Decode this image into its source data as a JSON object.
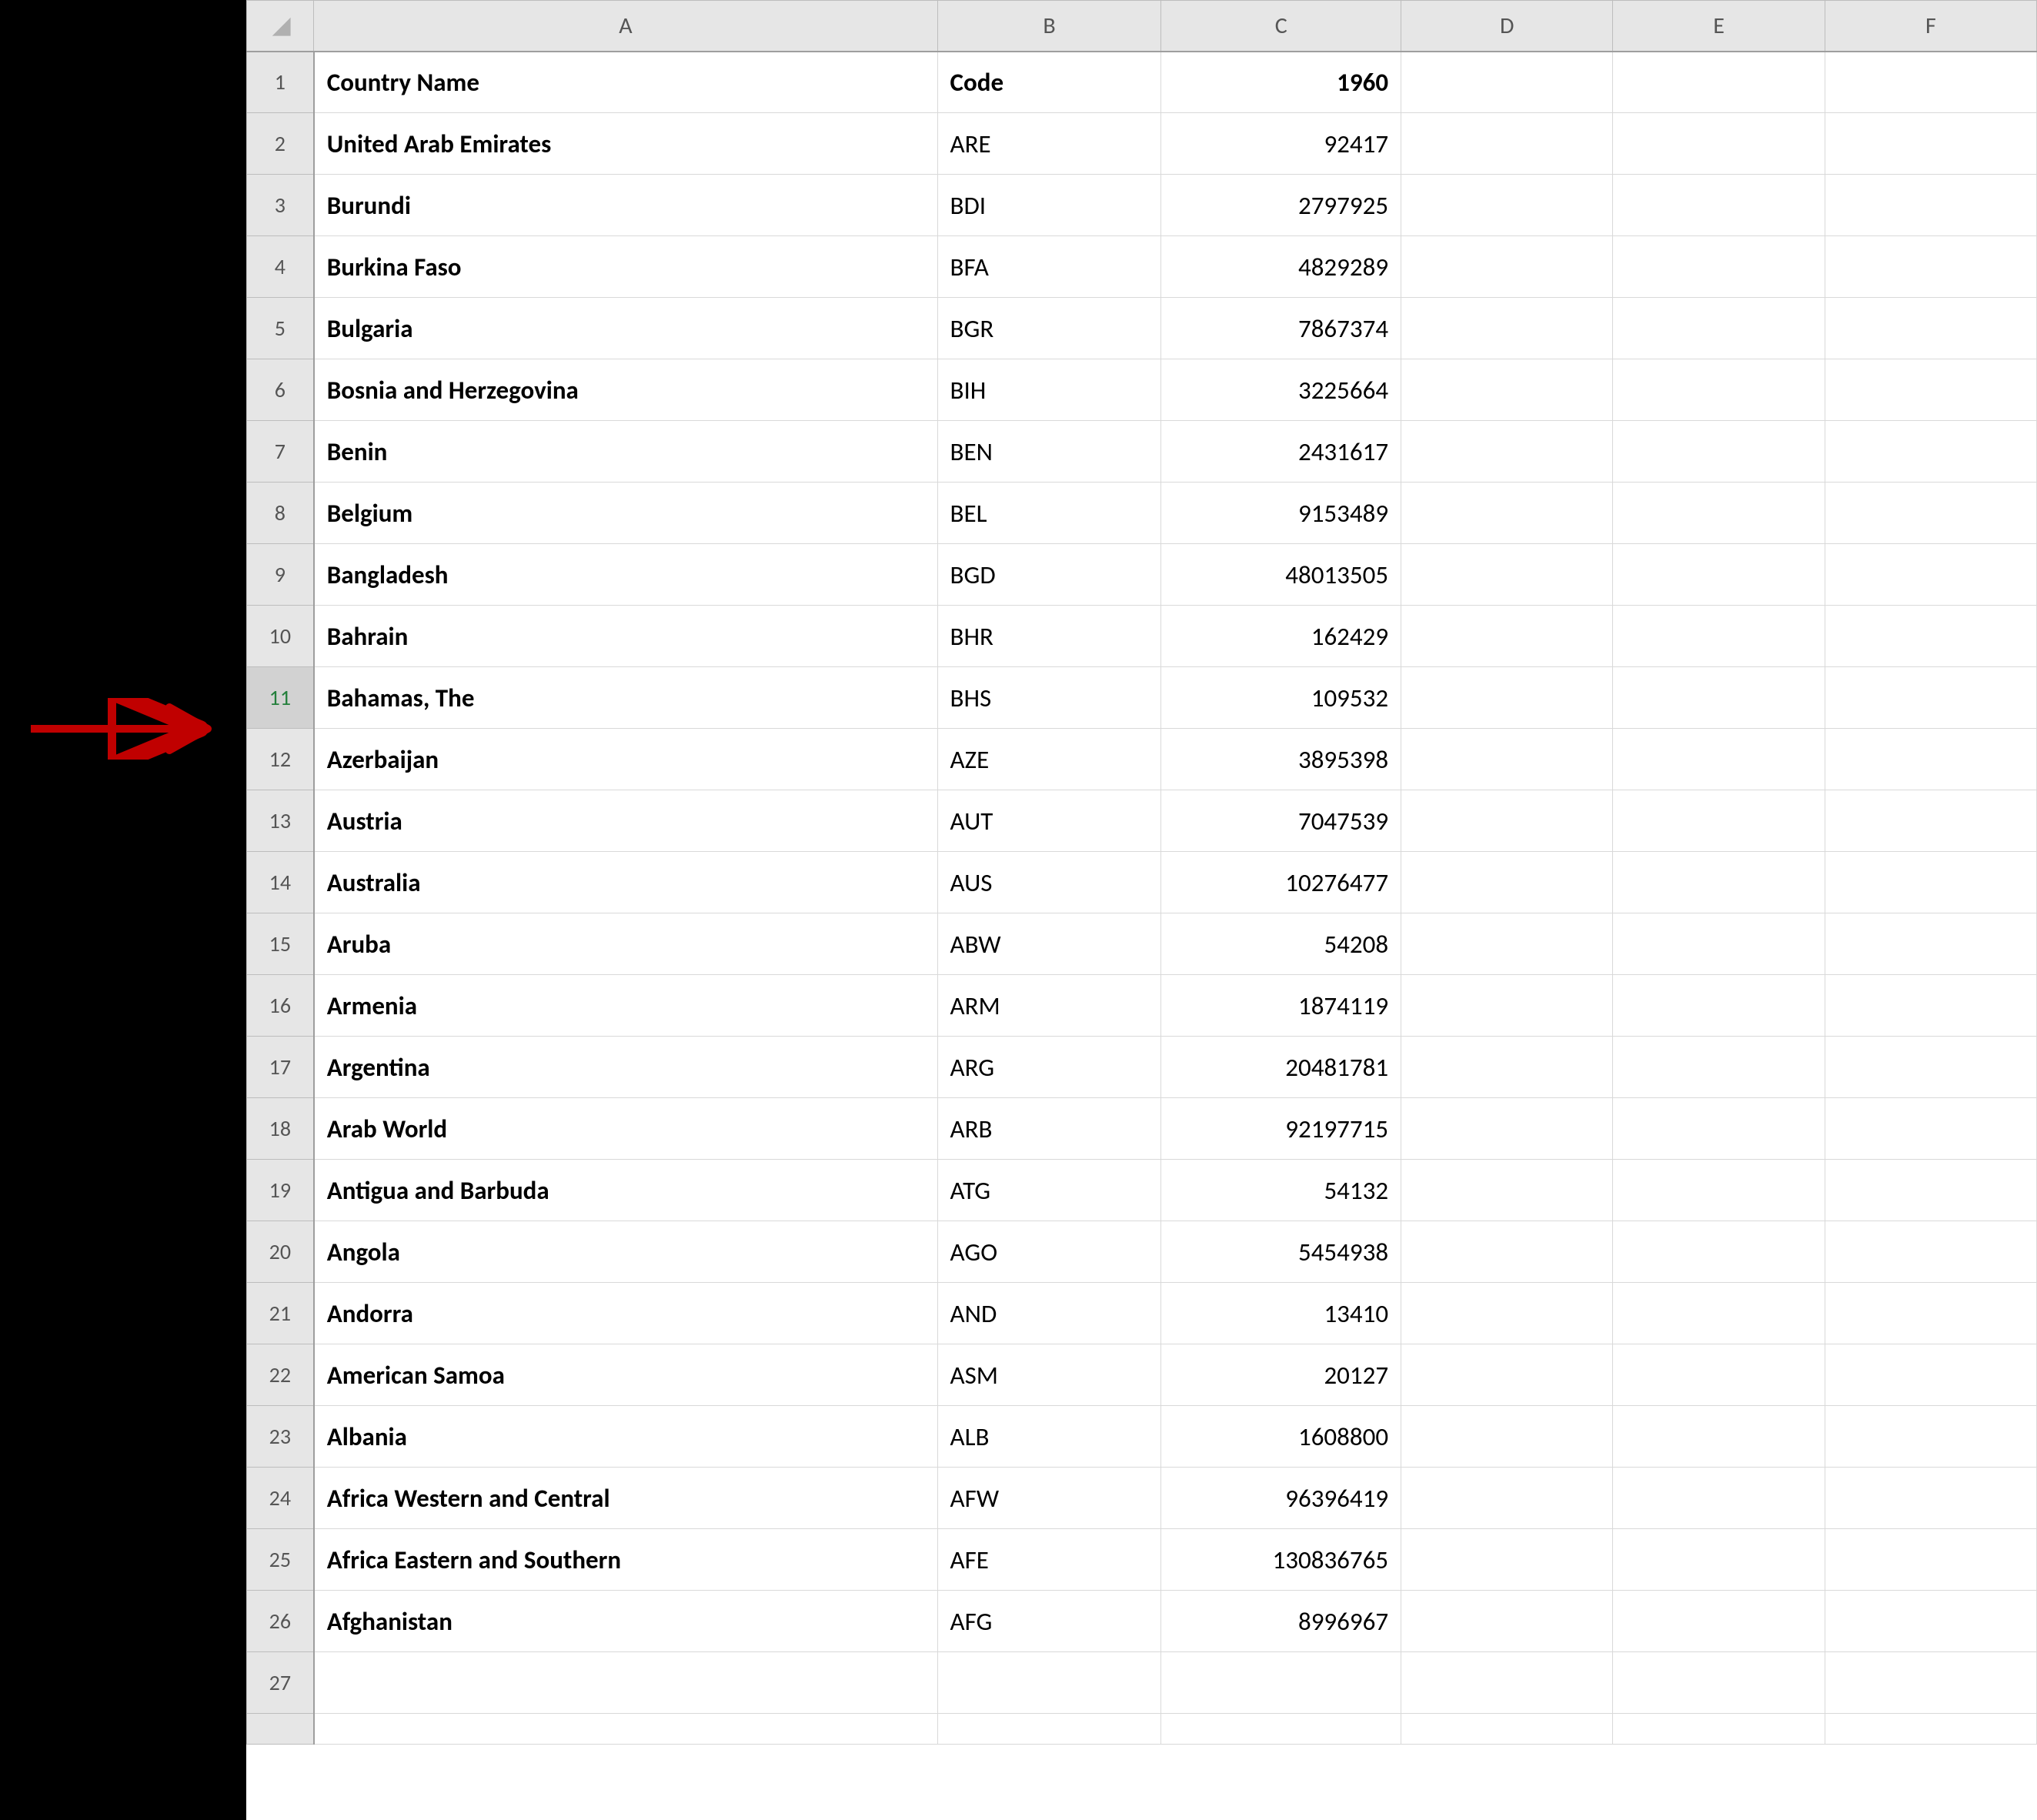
{
  "columns": [
    "A",
    "B",
    "C",
    "D",
    "E",
    "F"
  ],
  "header": {
    "A": "Country Name",
    "B": "Code",
    "C": "1960"
  },
  "rows": [
    {
      "n": "1",
      "A": "Country Name",
      "B": "Code",
      "C": "1960",
      "bold": true,
      "c_num": false,
      "is_header": true
    },
    {
      "n": "2",
      "A": "United Arab Emirates",
      "B": "ARE",
      "C": "92417",
      "bold": false,
      "c_num": true
    },
    {
      "n": "3",
      "A": "Burundi",
      "B": "BDI",
      "C": "2797925",
      "bold": false,
      "c_num": true
    },
    {
      "n": "4",
      "A": "Burkina Faso",
      "B": "BFA",
      "C": "4829289",
      "bold": false,
      "c_num": true
    },
    {
      "n": "5",
      "A": "Bulgaria",
      "B": "BGR",
      "C": "7867374",
      "bold": false,
      "c_num": true
    },
    {
      "n": "6",
      "A": "Bosnia and Herzegovina",
      "B": "BIH",
      "C": "3225664",
      "bold": false,
      "c_num": true
    },
    {
      "n": "7",
      "A": "Benin",
      "B": "BEN",
      "C": "2431617",
      "bold": false,
      "c_num": true
    },
    {
      "n": "8",
      "A": "Belgium",
      "B": "BEL",
      "C": "9153489",
      "bold": false,
      "c_num": true
    },
    {
      "n": "9",
      "A": "Bangladesh",
      "B": "BGD",
      "C": "48013505",
      "bold": false,
      "c_num": true
    },
    {
      "n": "10",
      "A": "Bahrain",
      "B": "BHR",
      "C": "162429",
      "bold": false,
      "c_num": true
    },
    {
      "n": "11",
      "A": "Bahamas, The",
      "B": "BHS",
      "C": "109532",
      "bold": false,
      "c_num": true,
      "highlight": true
    },
    {
      "n": "12",
      "A": "Azerbaijan",
      "B": "AZE",
      "C": "3895398",
      "bold": false,
      "c_num": true
    },
    {
      "n": "13",
      "A": "Austria",
      "B": "AUT",
      "C": "7047539",
      "bold": false,
      "c_num": true
    },
    {
      "n": "14",
      "A": "Australia",
      "B": "AUS",
      "C": "10276477",
      "bold": false,
      "c_num": true
    },
    {
      "n": "15",
      "A": "Aruba",
      "B": "ABW",
      "C": "54208",
      "bold": false,
      "c_num": true
    },
    {
      "n": "16",
      "A": "Armenia",
      "B": "ARM",
      "C": "1874119",
      "bold": false,
      "c_num": true
    },
    {
      "n": "17",
      "A": "Argentina",
      "B": "ARG",
      "C": "20481781",
      "bold": false,
      "c_num": true
    },
    {
      "n": "18",
      "A": "Arab World",
      "B": "ARB",
      "C": "92197715",
      "bold": false,
      "c_num": true
    },
    {
      "n": "19",
      "A": "Antigua and Barbuda",
      "B": "ATG",
      "C": "54132",
      "bold": false,
      "c_num": true
    },
    {
      "n": "20",
      "A": "Angola",
      "B": "AGO",
      "C": "5454938",
      "bold": false,
      "c_num": true
    },
    {
      "n": "21",
      "A": "Andorra",
      "B": "AND",
      "C": "13410",
      "bold": false,
      "c_num": true
    },
    {
      "n": "22",
      "A": "American Samoa",
      "B": "ASM",
      "C": "20127",
      "bold": false,
      "c_num": true
    },
    {
      "n": "23",
      "A": "Albania",
      "B": "ALB",
      "C": "1608800",
      "bold": false,
      "c_num": true
    },
    {
      "n": "24",
      "A": "Africa Western and Central",
      "B": "AFW",
      "C": "96396419",
      "bold": false,
      "c_num": true
    },
    {
      "n": "25",
      "A": "Africa Eastern and Southern",
      "B": "AFE",
      "C": "130836765",
      "bold": false,
      "c_num": true
    },
    {
      "n": "26",
      "A": "Afghanistan",
      "B": "AFG",
      "C": "8996967",
      "bold": false,
      "c_num": true
    },
    {
      "n": "27",
      "A": "",
      "B": "",
      "C": "",
      "bold": false,
      "c_num": false
    },
    {
      "n": "",
      "A": "",
      "B": "",
      "C": "",
      "bold": false,
      "c_num": false,
      "dense": true
    }
  ],
  "annotation": {
    "arrow_target_row": 11,
    "arrow_color": "#c00000"
  },
  "chart_data": {
    "type": "table",
    "columns": [
      "Country Name",
      "Code",
      "1960"
    ],
    "data": [
      [
        "United Arab Emirates",
        "ARE",
        92417
      ],
      [
        "Burundi",
        "BDI",
        2797925
      ],
      [
        "Burkina Faso",
        "BFA",
        4829289
      ],
      [
        "Bulgaria",
        "BGR",
        7867374
      ],
      [
        "Bosnia and Herzegovina",
        "BIH",
        3225664
      ],
      [
        "Benin",
        "BEN",
        2431617
      ],
      [
        "Belgium",
        "BEL",
        9153489
      ],
      [
        "Bangladesh",
        "BGD",
        48013505
      ],
      [
        "Bahrain",
        "BHR",
        162429
      ],
      [
        "Bahamas, The",
        "BHS",
        109532
      ],
      [
        "Azerbaijan",
        "AZE",
        3895398
      ],
      [
        "Austria",
        "AUT",
        7047539
      ],
      [
        "Australia",
        "AUS",
        10276477
      ],
      [
        "Aruba",
        "ABW",
        54208
      ],
      [
        "Armenia",
        "ARM",
        1874119
      ],
      [
        "Argentina",
        "ARG",
        20481781
      ],
      [
        "Arab World",
        "ARB",
        92197715
      ],
      [
        "Antigua and Barbuda",
        "ATG",
        54132
      ],
      [
        "Angola",
        "AGO",
        5454938
      ],
      [
        "Andorra",
        "AND",
        13410
      ],
      [
        "American Samoa",
        "ASM",
        20127
      ],
      [
        "Albania",
        "ALB",
        1608800
      ],
      [
        "Africa Western and Central",
        "AFW",
        96396419
      ],
      [
        "Africa Eastern and Southern",
        "AFE",
        130836765
      ],
      [
        "Afghanistan",
        "AFG",
        8996967
      ]
    ]
  }
}
